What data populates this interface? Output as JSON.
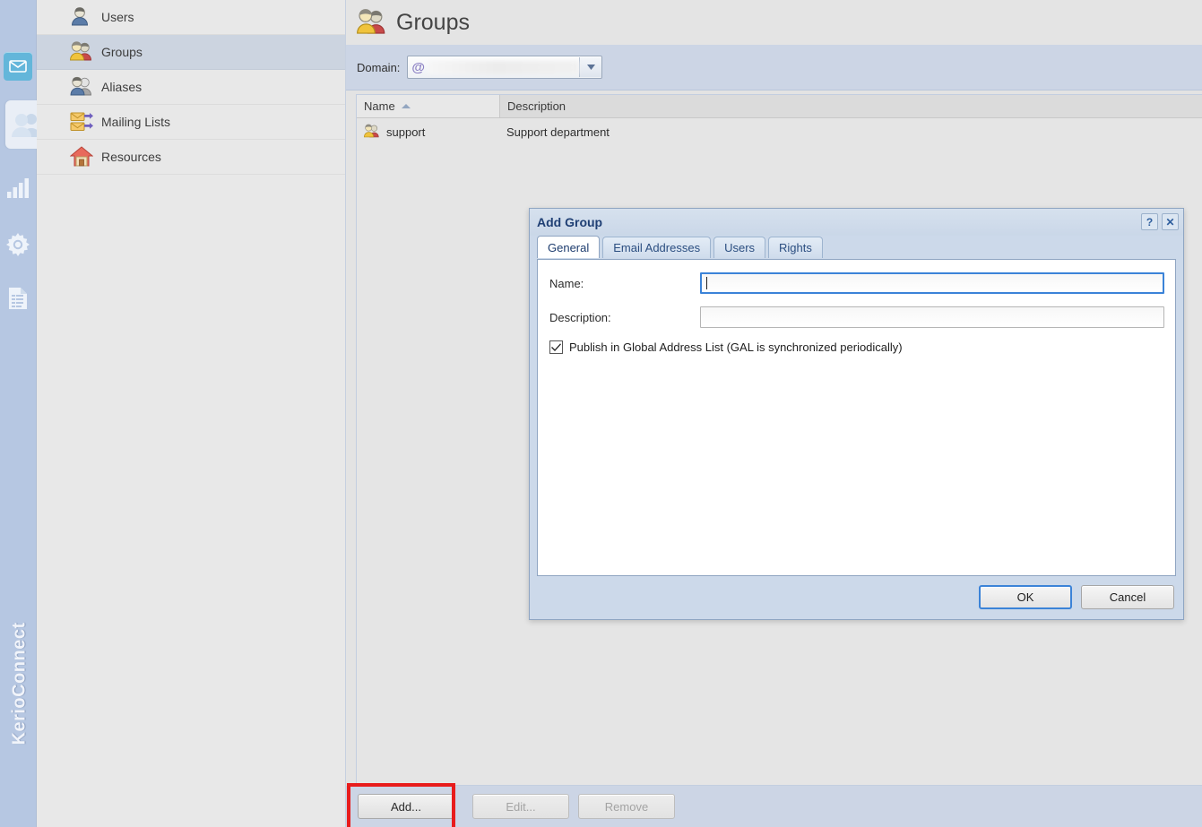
{
  "rail": {
    "items": [
      {
        "name": "mail-icon",
        "label": "Mail",
        "active": true
      },
      {
        "name": "accounts-icon",
        "label": "Accounts",
        "selected": true
      },
      {
        "name": "statistics-icon",
        "label": "Status"
      },
      {
        "name": "configuration-icon",
        "label": "Configuration"
      },
      {
        "name": "logs-icon",
        "label": "Logs"
      }
    ],
    "brand": "KerioConnect",
    "accent_active": "#63b6da",
    "background": "#b6c7e2"
  },
  "sidebar": {
    "items": [
      {
        "label": "Users",
        "icon": "user-icon",
        "selected": false
      },
      {
        "label": "Groups",
        "icon": "groups-icon",
        "selected": true
      },
      {
        "label": "Aliases",
        "icon": "aliases-icon",
        "selected": false
      },
      {
        "label": "Mailing Lists",
        "icon": "mailing-lists-icon",
        "selected": false
      },
      {
        "label": "Resources",
        "icon": "resources-icon",
        "selected": false
      }
    ],
    "selected_background": "#ccd4e0"
  },
  "header": {
    "title": "Groups",
    "icon": "groups-icon"
  },
  "domain": {
    "label": "Domain:",
    "prefix": "@",
    "value": "",
    "redacted": true,
    "dropdown_icon": "chevron-down-icon"
  },
  "list": {
    "columns": [
      "Name",
      "Description"
    ],
    "sort_column": "Name",
    "sort_direction": "asc",
    "rows": [
      {
        "name": "support",
        "description": "Support department",
        "icon": "groups-icon"
      }
    ]
  },
  "toolbar": {
    "add_label": "Add...",
    "edit_label": "Edit...",
    "remove_label": "Remove",
    "edit_disabled": true,
    "remove_disabled": true,
    "highlight_color": "#e81c1c",
    "highlighted_button": "Add..."
  },
  "dialog": {
    "title": "Add Group",
    "help_label": "?",
    "close_label": "✕",
    "tabs": [
      {
        "label": "General",
        "active": true
      },
      {
        "label": "Email Addresses",
        "active": false
      },
      {
        "label": "Users",
        "active": false
      },
      {
        "label": "Rights",
        "active": false
      }
    ],
    "fields": {
      "name_label": "Name:",
      "name_value": "",
      "name_focused": true,
      "description_label": "Description:",
      "description_value": ""
    },
    "checkbox": {
      "label": "Publish in Global Address List (GAL is synchronized periodically)",
      "checked": true,
      "mark": "✓"
    },
    "buttons": {
      "ok_label": "OK",
      "cancel_label": "Cancel",
      "default_button": "OK"
    }
  }
}
